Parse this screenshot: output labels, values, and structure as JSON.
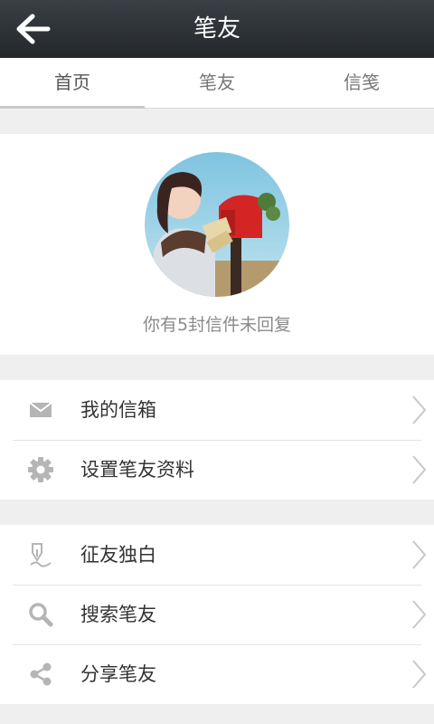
{
  "header": {
    "title": "笔友"
  },
  "tabs": [
    {
      "label": "首页",
      "active": true
    },
    {
      "label": "笔友",
      "active": false
    },
    {
      "label": "信笺",
      "active": false
    }
  ],
  "profile": {
    "unread_text": "你有5封信件未回复"
  },
  "menu_group_1": [
    {
      "label": "我的信箱",
      "icon": "mail-icon"
    },
    {
      "label": "设置笔友资料",
      "icon": "gear-icon"
    }
  ],
  "menu_group_2": [
    {
      "label": "征友独白",
      "icon": "pen-icon"
    },
    {
      "label": "搜索笔友",
      "icon": "search-icon"
    },
    {
      "label": "分享笔友",
      "icon": "share-icon"
    }
  ],
  "colors": {
    "header_bg": "#2b2f33",
    "page_bg": "#efefef",
    "icon_gray": "#b5b5b5"
  }
}
